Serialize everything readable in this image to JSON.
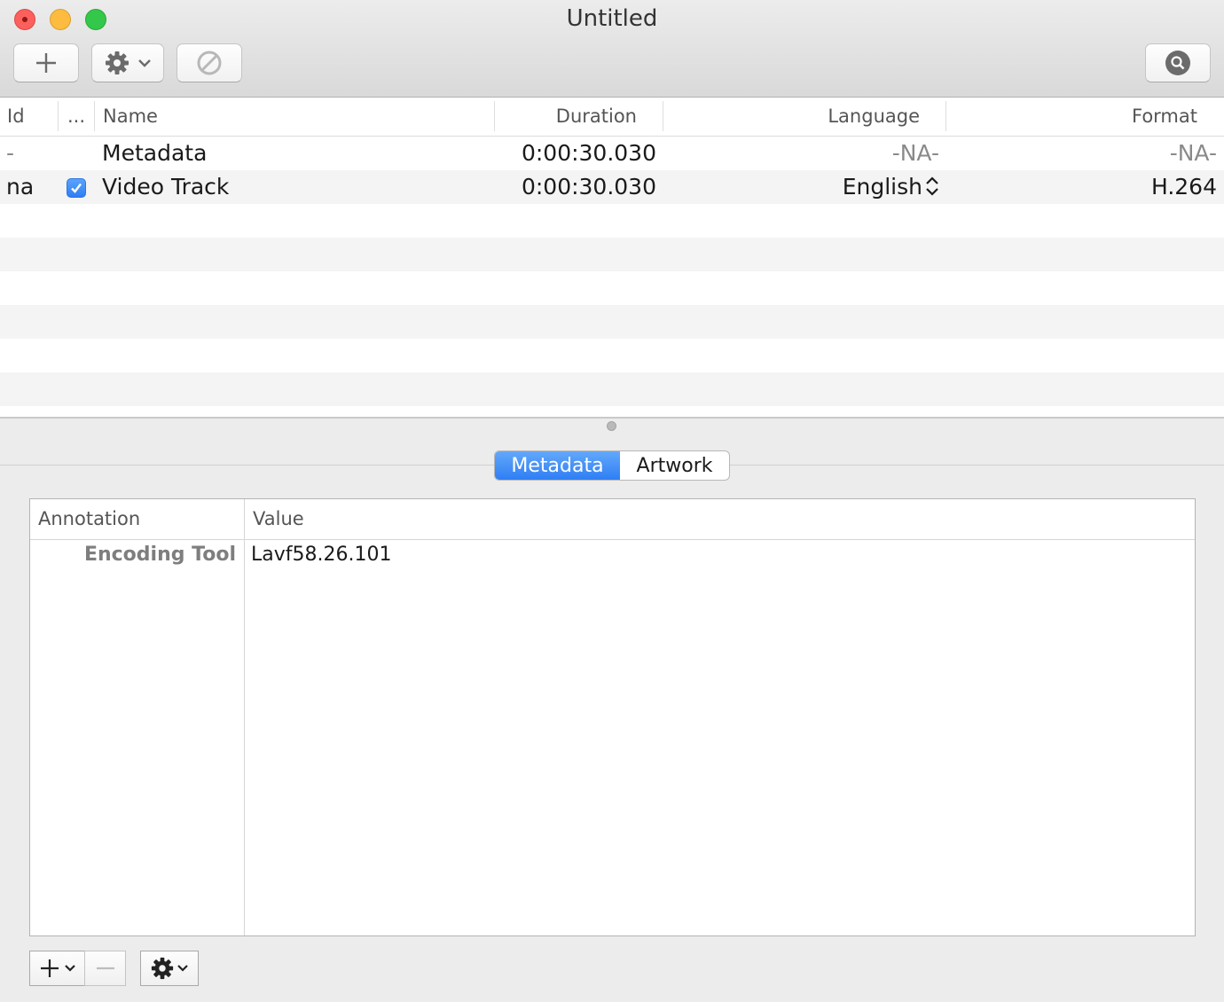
{
  "window": {
    "title": "Untitled"
  },
  "toolbar": {
    "buttons": [
      {
        "icon": "plus-icon"
      },
      {
        "icon": "gear-icon",
        "has_menu": true
      },
      {
        "icon": "prohibited-icon",
        "disabled": true
      },
      {
        "icon": "search-icon"
      }
    ]
  },
  "tracks": {
    "columns": {
      "id": "Id",
      "enabled": "...",
      "name": "Name",
      "duration": "Duration",
      "language": "Language",
      "format": "Format"
    },
    "rows": [
      {
        "id": "-",
        "enabled": null,
        "name": "Metadata",
        "duration": "0:00:30.030",
        "language": "-NA-",
        "format": "-NA-"
      },
      {
        "id": "na",
        "enabled": true,
        "name": "Video Track",
        "duration": "0:00:30.030",
        "language": "English",
        "format": "H.264"
      }
    ]
  },
  "tabs": {
    "items": [
      "Metadata",
      "Artwork"
    ],
    "selected": "Metadata"
  },
  "metadata": {
    "columns": {
      "annotation": "Annotation",
      "value": "Value"
    },
    "rows": [
      {
        "annotation": "Encoding Tool",
        "value": "Lavf58.26.101"
      }
    ]
  },
  "colors": {
    "accent": "#2f7ff4",
    "close": "#fc605c",
    "minimize": "#fdbc40",
    "maximize": "#34c84a"
  }
}
